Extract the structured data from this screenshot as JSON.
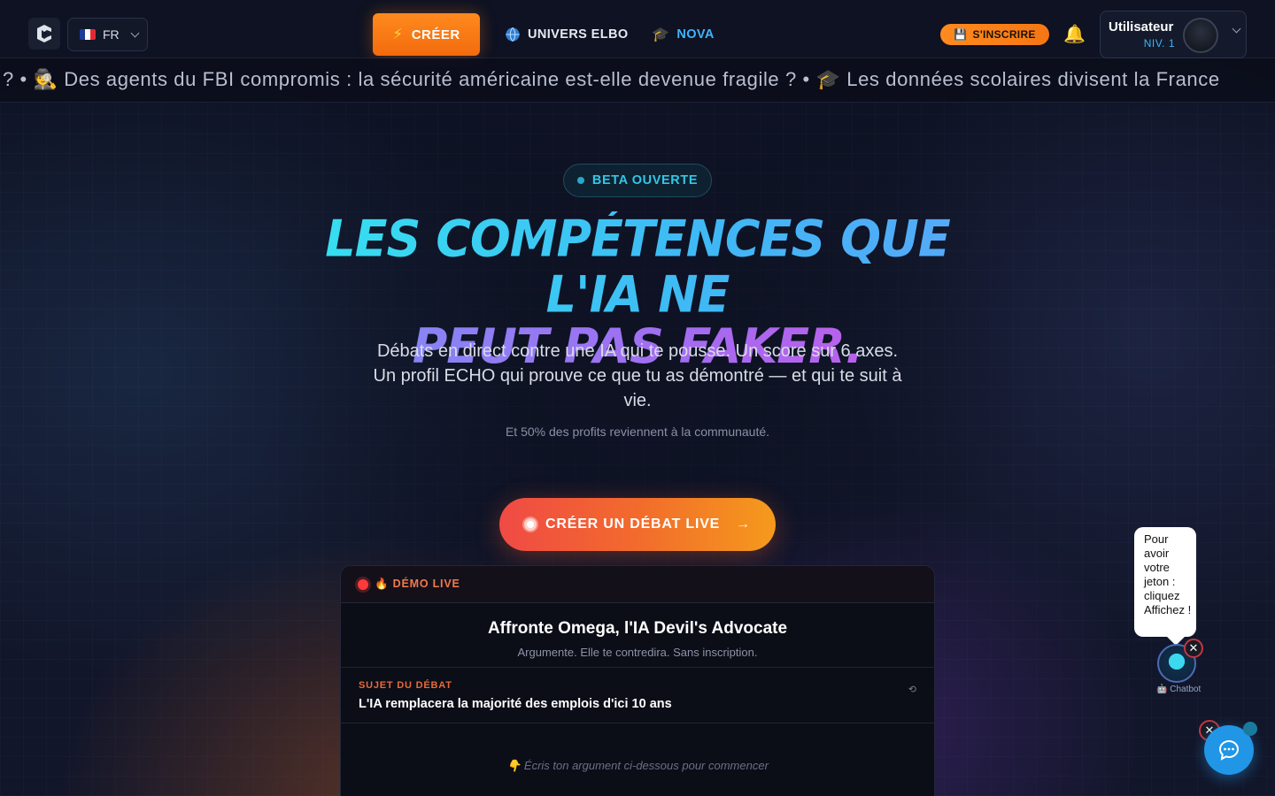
{
  "header": {
    "lang": {
      "code": "FR",
      "flag": "fr-flag-icon"
    },
    "create_button": "CRÉER",
    "nav": [
      {
        "label": "UNIVERS ELBO",
        "icon": "globe-icon",
        "color": "#e6e9f2"
      },
      {
        "label": "NOVA",
        "icon": "graduation-cap-icon",
        "color": "#3fb4ff"
      }
    ],
    "signup_button": "S'INSCRIRE",
    "user": {
      "name": "Utilisateur",
      "level": "NIV. 1"
    }
  },
  "ticker": {
    "text": "? • 🕵️ Des agents du FBI compromis : la sécurité américaine est-elle devenue fragile ? • 🎓 Les données scolaires divisent la France"
  },
  "hero": {
    "badge": "BETA OUVERTE",
    "headline_line1": "Les compétences que l'IA ne",
    "headline_line2": "peut pas faker.",
    "subtitle": "Débats en direct contre une IA qui te pousse. Un score sur 6 axes. Un profil ECHO qui prouve ce que tu as démontré — et qui te suit à vie.",
    "note": "Et 50% des profits reviennent à la communauté.",
    "cta": "CRÉER UN DÉBAT LIVE",
    "cta_arrow": "→"
  },
  "demo": {
    "label": "🔥 DÉMO LIVE",
    "title": "Affronte Omega, l'IA Devil's Advocate",
    "subtitle": "Argumente. Elle te contredira. Sans inscription.",
    "topic_label": "SUJET DU DÉBAT",
    "topic": "L'IA remplacera la majorité des emplois d'ici 10 ans",
    "refresh_icon": "⟲",
    "prompt": "👇 Écris ton argument ci-dessous pour commencer"
  },
  "chatbot": {
    "bubble": "Pour avoir votre jeton : cliquez Affichez !",
    "label": "🤖 Chatbot",
    "close": "✕"
  },
  "colors": {
    "accent_orange": "#f57614",
    "accent_cyan": "#33c6e6",
    "nova_blue": "#3fb4ff"
  }
}
